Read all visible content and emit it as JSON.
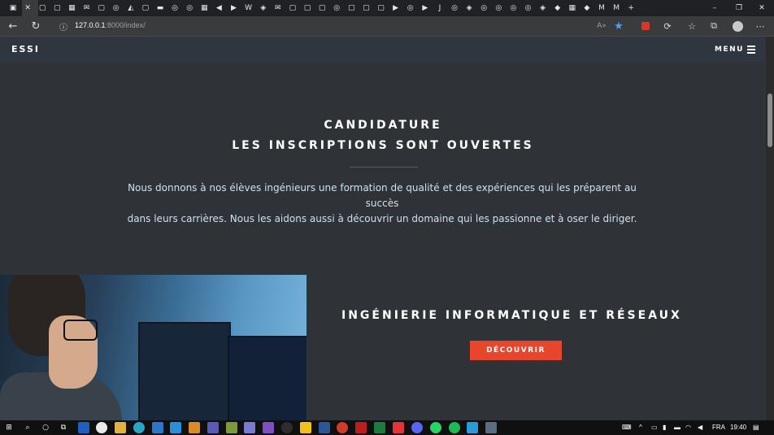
{
  "browser": {
    "tab_glyphs": [
      "▣",
      "✕",
      "▢",
      "▢",
      "▦",
      "✉",
      "▢",
      "◎",
      "◭",
      "▢",
      "▬",
      "◎",
      "◎",
      "▦",
      "◀",
      "▶",
      "W",
      "◈",
      "✉",
      "▢",
      "▢",
      "▢",
      "◎",
      "▢",
      "▢",
      "▢",
      "▶",
      "◎",
      "▶",
      "J",
      "◎",
      "◈",
      "◎",
      "◎",
      "◎",
      "◎",
      "◈",
      "◆",
      "▦",
      "◆",
      "M",
      "M",
      "+"
    ],
    "window_controls": {
      "minimize": "–",
      "restore": "❐",
      "close": "✕"
    },
    "url_host": "127.0.0.1",
    "url_rest": ":8000/index/",
    "read_aloud": "A»"
  },
  "nav": {
    "brand": "ESSI",
    "menu_label": "MENU"
  },
  "hero": {
    "title_line1": "CANDIDATURE",
    "title_line2": "LES INSCRIPTIONS SONT OUVERTES",
    "lead_line1": "Nous donnons à nos élèves ingénieurs une formation de qualité et des expériences qui les préparent au succès",
    "lead_line2": "dans leurs carrières. Nous les aidons aussi à découvrir un domaine qui les passionne et à oser le diriger."
  },
  "program": {
    "title": "INGÉNIERIE INFORMATIQUE ET RÉSEAUX",
    "button_label": "DÉCOUVRIR"
  },
  "taskbar": {
    "lang": "FRA",
    "time": "19:40"
  },
  "colors": {
    "page_bg": "#2f3237",
    "navbar_bg": "#2f3640",
    "accent": "#e8452d",
    "lead_text": "#cfe0ef"
  }
}
